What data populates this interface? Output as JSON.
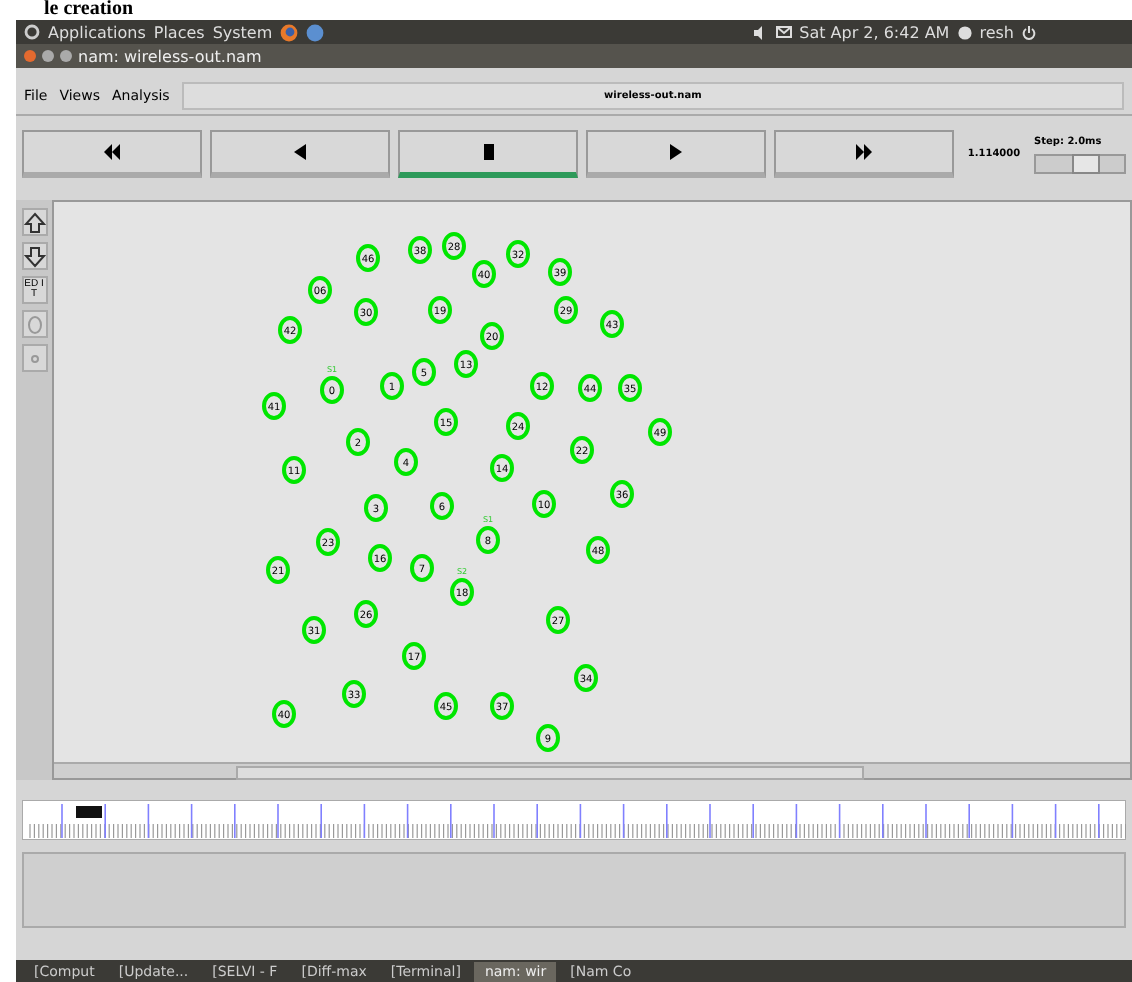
{
  "caption": "le creation",
  "top_panel": {
    "menus": [
      "Applications",
      "Places",
      "System"
    ],
    "clock": "Sat Apr 2,  6:42 AM",
    "user": "resh"
  },
  "window": {
    "title": "nam: wireless-out.nam"
  },
  "menu": [
    "File",
    "Views",
    "Analysis"
  ],
  "file_label": "wireless-out.nam",
  "controls": [
    {
      "kind": "rewind",
      "selected": false
    },
    {
      "kind": "back",
      "selected": false
    },
    {
      "kind": "stop",
      "selected": true
    },
    {
      "kind": "play",
      "selected": false
    },
    {
      "kind": "forward",
      "selected": false
    }
  ],
  "time": "1.114000",
  "step": {
    "label": "Step: 2.0ms",
    "level": 0.55
  },
  "side_tools": [
    {
      "kind": "zoom-in"
    },
    {
      "kind": "zoom-out"
    },
    {
      "kind": "edit",
      "label": "ED IT"
    },
    {
      "kind": "ring"
    },
    {
      "kind": "dot"
    }
  ],
  "nodes": [
    {
      "label": "46"
    },
    {
      "label": "38"
    },
    {
      "label": "28"
    },
    {
      "label": "32"
    },
    {
      "label": "40"
    },
    {
      "label": "39"
    },
    {
      "label": "06"
    },
    {
      "label": "30"
    },
    {
      "label": "19"
    },
    {
      "label": "29"
    },
    {
      "label": "42"
    },
    {
      "label": "20"
    },
    {
      "label": "43"
    },
    {
      "label": "0",
      "tag": "S1"
    },
    {
      "label": "1"
    },
    {
      "label": "5"
    },
    {
      "label": "13"
    },
    {
      "label": "12"
    },
    {
      "label": "44"
    },
    {
      "label": "35"
    },
    {
      "label": "41"
    },
    {
      "label": "2"
    },
    {
      "label": "15"
    },
    {
      "label": "24"
    },
    {
      "label": "22"
    },
    {
      "label": "49"
    },
    {
      "label": "11"
    },
    {
      "label": "4"
    },
    {
      "label": "14"
    },
    {
      "label": "3"
    },
    {
      "label": "6"
    },
    {
      "label": "10"
    },
    {
      "label": "36"
    },
    {
      "label": "21"
    },
    {
      "label": "23"
    },
    {
      "label": "16"
    },
    {
      "label": "7"
    },
    {
      "label": "8",
      "tag": "S1"
    },
    {
      "label": "48"
    },
    {
      "label": "18",
      "tag": "S2"
    },
    {
      "label": "31"
    },
    {
      "label": "26"
    },
    {
      "label": "27"
    },
    {
      "label": "17"
    },
    {
      "label": "34"
    },
    {
      "label": "40"
    },
    {
      "label": "33"
    },
    {
      "label": "45"
    },
    {
      "label": "37"
    },
    {
      "label": "9"
    }
  ],
  "taskbar": [
    {
      "label": "[Comput",
      "selected": false
    },
    {
      "label": "[Update...",
      "selected": false
    },
    {
      "label": "[SELVI - F",
      "selected": false
    },
    {
      "label": "[Diff-max",
      "selected": false
    },
    {
      "label": "[Terminal]",
      "selected": false
    },
    {
      "label": "nam: wir",
      "selected": true
    },
    {
      "label": "[Nam Co",
      "selected": false
    }
  ]
}
